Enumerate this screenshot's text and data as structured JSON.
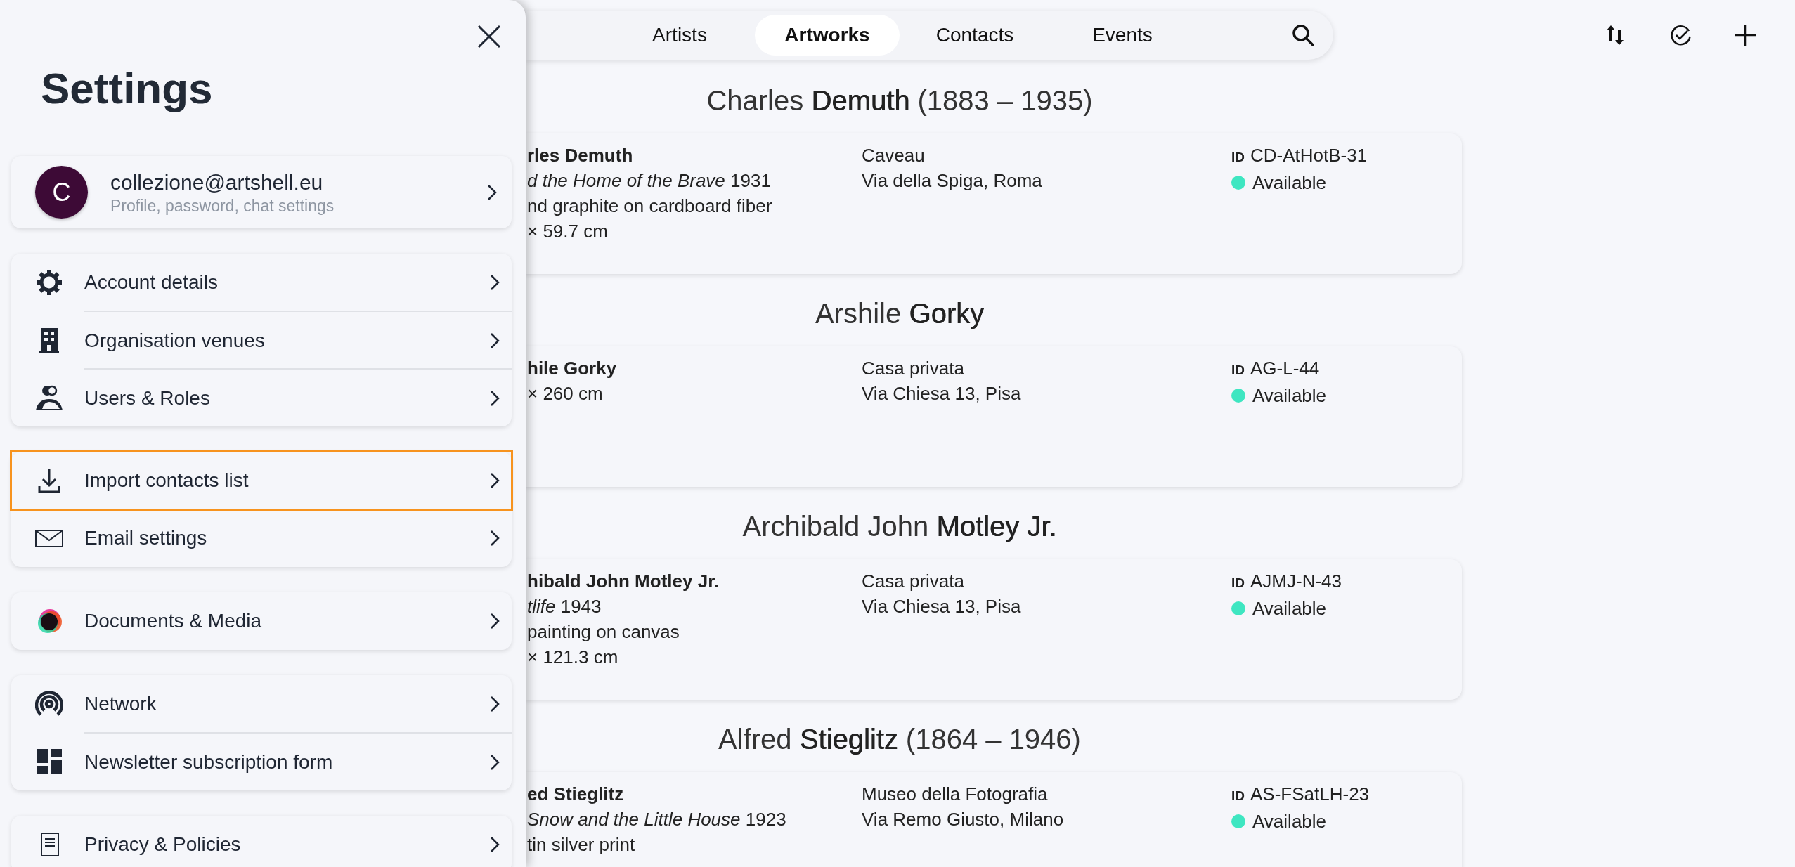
{
  "settings_panel": {
    "title": "Settings",
    "profile": {
      "avatar_letter": "C",
      "email": "collezione@artshell.eu",
      "subtitle": "Profile, password, chat settings"
    },
    "groups": [
      {
        "items": [
          {
            "label": "Account details",
            "selected": false
          },
          {
            "label": "Organisation venues",
            "selected": false
          },
          {
            "label": "Users & Roles",
            "selected": false
          }
        ]
      },
      {
        "items": [
          {
            "label": "Import contacts list",
            "selected": true
          },
          {
            "label": "Email settings",
            "selected": false
          }
        ]
      },
      {
        "items": [
          {
            "label": "Documents & Media",
            "selected": false
          }
        ]
      },
      {
        "items": [
          {
            "label": "Network",
            "selected": false
          },
          {
            "label": "Newsletter subscription form",
            "selected": false
          }
        ]
      },
      {
        "items": [
          {
            "label": "Privacy & Policies",
            "selected": false
          }
        ]
      }
    ]
  },
  "tabs": [
    {
      "label": "Artists",
      "selected": false
    },
    {
      "label": "Artworks",
      "selected": true
    },
    {
      "label": "Contacts",
      "selected": false
    },
    {
      "label": "Events",
      "selected": false
    }
  ],
  "sections": [
    {
      "heading": "Charles **Demuth** (1883 – 1935)",
      "artwork": {
        "lines": [
          "rles Demuth",
          "*d the Home of the Brave* 1931",
          "nd graphite on cardboard fiber",
          "× 59.7 cm"
        ],
        "location": [
          "Caveau",
          "Via della Spiga, Roma"
        ],
        "id_label": "ID",
        "id": "CD-AtHotB-31",
        "status": "Available",
        "color": "#3ee6c1"
      }
    },
    {
      "heading": "Arshile **Gorky**",
      "artwork": {
        "lines": [
          "hile Gorky",
          "× 260 cm"
        ],
        "location": [
          "Casa privata",
          "Via Chiesa 13, Pisa"
        ],
        "id_label": "ID",
        "id": "AG-L-44",
        "status": "Available",
        "color": "#3ee6c1"
      }
    },
    {
      "heading": "Archibald John **Motley Jr.**",
      "artwork": {
        "lines": [
          "hibald John Motley Jr.",
          "*tlife* 1943",
          "painting on canvas",
          "× 121.3 cm"
        ],
        "location": [
          "Casa privata",
          "Via Chiesa 13, Pisa"
        ],
        "id_label": "ID",
        "id": "AJMJ-N-43",
        "status": "Available",
        "color": "#3ee6c1"
      }
    },
    {
      "heading": "Alfred **Stieglitz** (1864 – 1946)",
      "artwork": {
        "lines": [
          "ed Stieglitz",
          "*Snow and the Little House* 1923",
          "tin silver print"
        ],
        "location": [
          "Museo della Fotografia",
          "Via Remo Giusto, Milano"
        ],
        "id_label": "ID",
        "id": "AS-FSatLH-23",
        "status": "Available",
        "color": "#3ee6c1"
      }
    }
  ]
}
